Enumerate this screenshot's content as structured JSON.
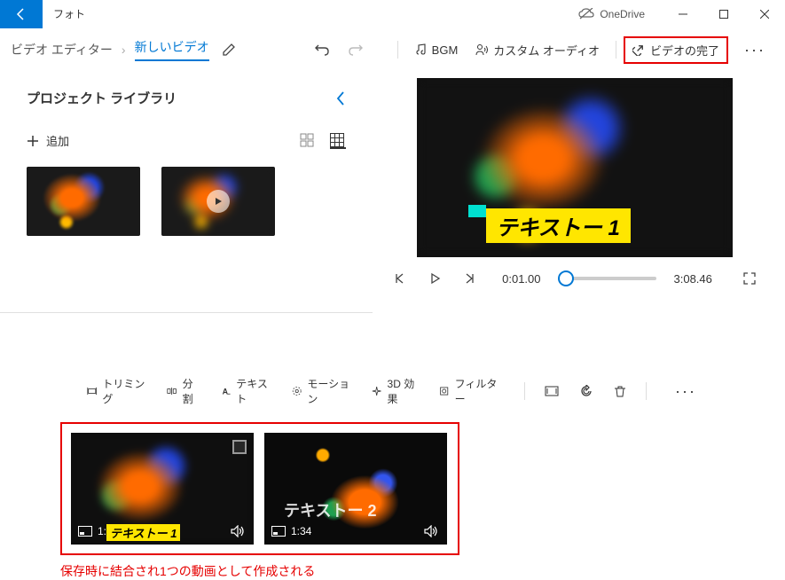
{
  "titlebar": {
    "app_title": "フォト",
    "onedrive_label": "OneDrive"
  },
  "breadcrumb": {
    "root": "ビデオ エディター",
    "current": "新しいビデオ"
  },
  "toolbar": {
    "bgm": "BGM",
    "custom_audio": "カスタム オーディオ",
    "finish": "ビデオの完了"
  },
  "library": {
    "title": "プロジェクト ライブラリ",
    "add_label": "追加"
  },
  "preview": {
    "overlay_text": "テキストー 1"
  },
  "playback": {
    "current_time": "0:01.00",
    "total_time": "3:08.46"
  },
  "editbar": {
    "trimming": "トリミング",
    "split": "分割",
    "text": "テキスト",
    "motion": "モーション",
    "fx3d": "3D 効果",
    "filter": "フィルター"
  },
  "clips": [
    {
      "duration": "1:34",
      "text_overlay": "テキストー 1"
    },
    {
      "duration": "1:34",
      "text_overlay": "テキストー 2"
    }
  ],
  "caption": "保存時に結合され1つの動画として作成される"
}
